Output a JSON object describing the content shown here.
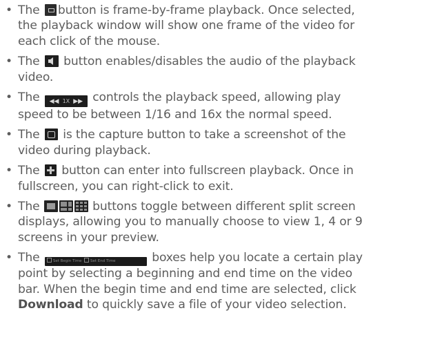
{
  "bullet_char": "•",
  "items": [
    {
      "id": "frame",
      "lead": "The",
      "icon": "frame-by-frame-icon",
      "rest_first": "button is frame-by-frame playback. Once selected,",
      "lines": [
        "the playback window will show one frame of the video for",
        "each click of the mouse."
      ]
    },
    {
      "id": "audio",
      "lead": "The",
      "icon": "audio-icon",
      "rest_first": " button enables/disables the audio of the playback",
      "lines": [
        "video."
      ]
    },
    {
      "id": "speed",
      "lead": "The",
      "icon": "speed-control-icon",
      "speed_label": "1X",
      "rest_first": "controls the playback speed, allowing play",
      "lines": [
        "speed to be between 1/16 and 16x the normal speed."
      ]
    },
    {
      "id": "capture",
      "lead": "The",
      "icon": "capture-camera-icon",
      "rest_first": "is the capture button to take a screenshot of the",
      "lines": [
        "video during playback."
      ]
    },
    {
      "id": "fullscreen",
      "lead": "The",
      "icon": "fullscreen-icon",
      "rest_first": "button can enter into fullscreen playback. Once in",
      "lines": [
        "fullscreen, you can right-click to exit."
      ]
    },
    {
      "id": "split",
      "lead": "The",
      "icon": "split-screen-icons",
      "rest_first": " buttons toggle between different split screen",
      "lines": [
        "displays, allowing you to manually choose to view 1, 4 or 9",
        "screens in your preview."
      ]
    },
    {
      "id": "time",
      "lead": "The",
      "icon": "begin-end-time-boxes-icon",
      "time_labels": [
        "Set Begin Time",
        "Set End Time"
      ],
      "rest_first": "boxes help you locate a certain play",
      "lines": [
        "point by selecting a beginning and end time on the video",
        "bar. When the begin time and end time are selected, click"
      ],
      "last_bold": "Download",
      "last_rest": " to quickly save a file of your video selection."
    }
  ]
}
